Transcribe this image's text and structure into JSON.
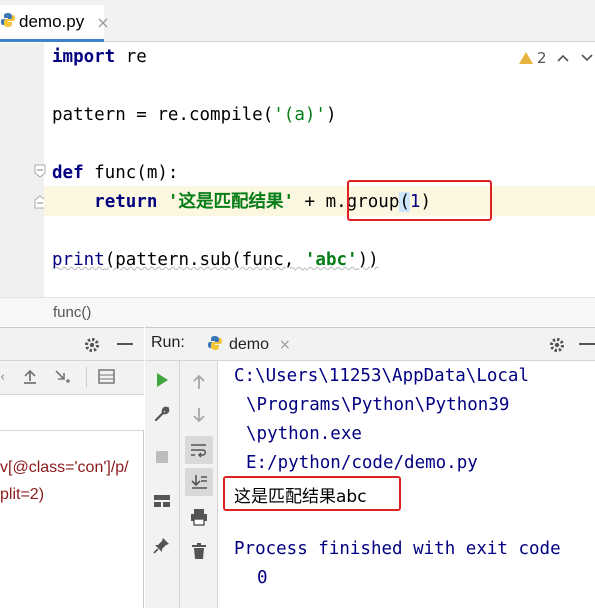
{
  "editor_tab": {
    "filename": "demo.py",
    "close": "×"
  },
  "inspections": {
    "count": "2"
  },
  "code": {
    "l1_kw": "import",
    "l1_rest": " re",
    "l3_a": "pattern = re.compile(",
    "l3_str": "'(a)'",
    "l3_b": ")",
    "l5_kw": "def",
    "l5_fn": " func",
    "l5_rest": "(m):",
    "l6_kw": "return",
    "l6_str": "'这是匹配结果'",
    "l6_plus": " + ",
    "l6_call": "m.group",
    "l6_open": "(",
    "l6_arg": "1",
    "l6_close": ")",
    "l8_print": "print",
    "l8_a": "(pattern.sub(func, ",
    "l8_str": "'abc'",
    "l8_b": "))"
  },
  "breadcrumb": {
    "text": "func()"
  },
  "left_panel": {
    "line1": "v[@class='con']/p/",
    "line2": "plit=2)"
  },
  "run_panel": {
    "label": "Run:",
    "tab": "demo",
    "close": "×",
    "output": {
      "l1": "C:\\Users\\11253\\AppData\\Local",
      "l2": "\\Programs\\Python\\Python39",
      "l3": "\\python.exe",
      "l4": "E:/python/code/demo.py",
      "result_cn": "这是匹配结果",
      "result_abc": "abc",
      "l6": "Process finished with exit code",
      "l7": "0"
    }
  },
  "colors": {
    "keyword": "#000080",
    "string": "#067d17",
    "highlight_box": "#e02020",
    "accent": "#4083c9"
  }
}
